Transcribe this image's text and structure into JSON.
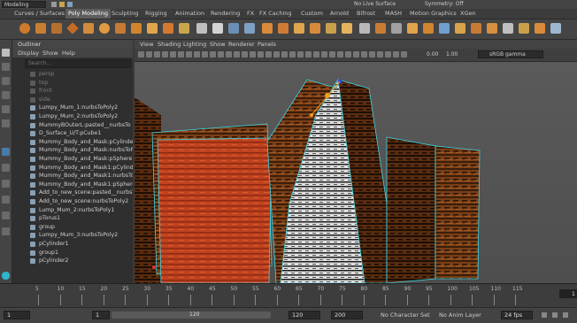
{
  "app": {
    "mode": "Modeling",
    "live_surface": "No Live Surface",
    "symmetry": "Symmetry: Off"
  },
  "shelf_tabs": [
    "Curves / Surfaces",
    "Poly Modeling",
    "Sculpting",
    "Rigging",
    "Animation",
    "Rendering",
    "FX",
    "FX Caching",
    "Custom",
    "Arnold",
    "Bifrost",
    "MASH",
    "Motion Graphics",
    "XGen"
  ],
  "shelf_active": "Poly Modeling",
  "outliner": {
    "title": "Outliner",
    "menu": [
      "Display",
      "Show",
      "Help"
    ],
    "search_placeholder": "Search...",
    "items": [
      {
        "label": "persp",
        "dim": true
      },
      {
        "label": "top",
        "dim": true
      },
      {
        "label": "front",
        "dim": true
      },
      {
        "label": "side",
        "dim": true
      },
      {
        "label": "Lumpy_Mum_1:nurbsToPoly2",
        "dim": false
      },
      {
        "label": "Lumpy_Mum_2:nurbsToPoly2",
        "dim": false
      },
      {
        "label": "MummyBOuterL:pasted__nurbsTo",
        "dim": false
      },
      {
        "label": "D_Surface_U/T:pCube1",
        "dim": false
      },
      {
        "label": "Mummy_Body_and_Mask:pCylinder2",
        "dim": false
      },
      {
        "label": "Mummy_Body_and_Mask:nurbsToPo",
        "dim": false
      },
      {
        "label": "Mummy_Body_and_Mask:pSphere1",
        "dim": false
      },
      {
        "label": "Mummy_Body_and_Mask1:pCylinde",
        "dim": false
      },
      {
        "label": "Mummy_Body_and_Mask1:nurbsTo",
        "dim": false
      },
      {
        "label": "Mummy_Body_and_Mask1:pSphere1",
        "dim": false
      },
      {
        "label": "Add_to_new_scene:pasted__nurbsT",
        "dim": false
      },
      {
        "label": "Add_to_new_scene:nurbsToPoly2",
        "dim": false
      },
      {
        "label": "Lump_Mum_2:nurbsToPoly1",
        "dim": false
      },
      {
        "label": "pTorus1",
        "dim": false
      },
      {
        "label": "group",
        "dim": false
      },
      {
        "label": "Lumpy_Mum_3:nurbsToPoly2",
        "dim": false
      },
      {
        "label": "pCylinder1",
        "dim": false
      },
      {
        "label": "group1",
        "dim": false
      },
      {
        "label": "pCylinder2",
        "dim": false
      }
    ]
  },
  "viewport": {
    "menu": [
      "View",
      "Shading",
      "Lighting",
      "Show",
      "Renderer",
      "Panels"
    ],
    "exposure": "0.00",
    "gamma_value": "1.00",
    "color_space": "sRGB gamma"
  },
  "timeline": {
    "ticks": [
      "5",
      "10",
      "15",
      "20",
      "25",
      "30",
      "35",
      "40",
      "45",
      "50",
      "55",
      "60",
      "65",
      "70",
      "75",
      "80",
      "85",
      "90",
      "95",
      "100",
      "105",
      "110",
      "115"
    ],
    "current_frame": "1"
  },
  "range": {
    "start": "1",
    "start_inner": "1",
    "end_inner": "120",
    "end": "120",
    "end_outer": "200",
    "character_set": "No Character Set",
    "anim_layer": "No Anim Layer",
    "fps": "24 fps"
  },
  "colors": {
    "selection_cyan": "#3ad6e6",
    "wood_dark": "#3c1e0b",
    "wood_light": "#8b4a1e",
    "red_panel": "#b8351c",
    "white_stripe": "#d8d8d8"
  }
}
